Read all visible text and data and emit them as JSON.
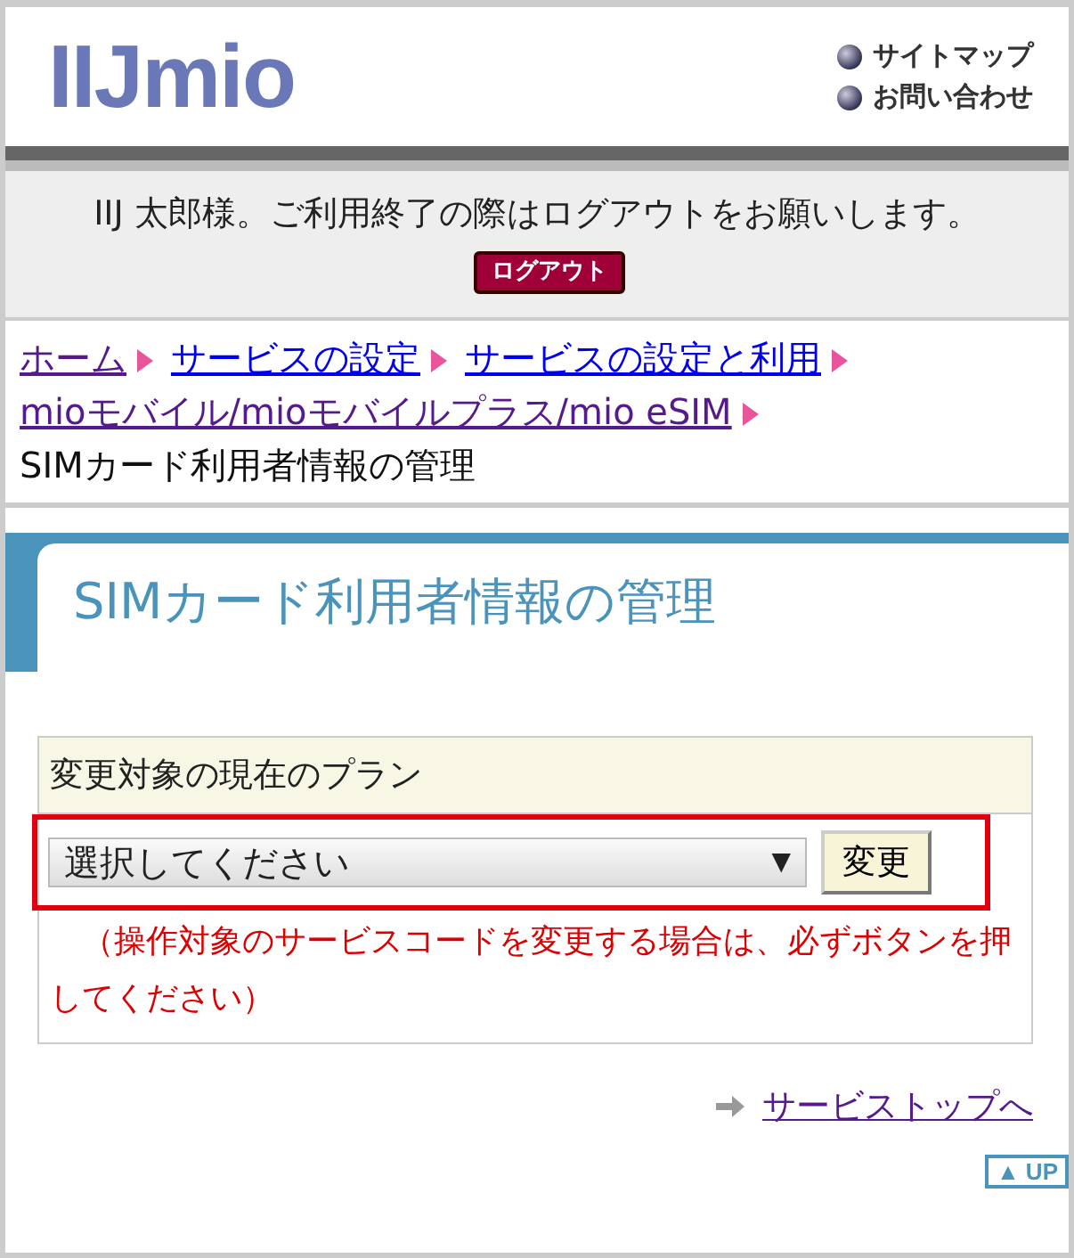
{
  "header": {
    "logo": "IIJmio",
    "links": [
      {
        "label": "サイトマップ"
      },
      {
        "label": "お問い合わせ"
      }
    ]
  },
  "notice": {
    "text": "IIJ 太郎様。ご利用終了の際はログアウトをお願いします。",
    "logout_button": "ログアウト"
  },
  "breadcrumb": [
    {
      "label": "ホーム",
      "kind": "link",
      "visited": true
    },
    {
      "label": "サービスの設定",
      "kind": "link",
      "visited": false
    },
    {
      "label": "サービスの設定と利用",
      "kind": "link",
      "visited": false
    },
    {
      "label": "mioモバイル/mioモバイルプラス/mio eSIM",
      "kind": "link",
      "visited": true
    },
    {
      "label": "SIMカード利用者情報の管理",
      "kind": "current"
    }
  ],
  "page_title": "SIMカード利用者情報の管理",
  "plan_form": {
    "heading": "変更対象の現在のプラン",
    "select": {
      "value": "選択してください",
      "arrow": "▼"
    },
    "button": "変更",
    "note": "（操作対象のサービスコードを変更する場合は、必ずボタンを押してください）"
  },
  "service_top_link": "サービストップへ",
  "up_button": "▲ UP"
}
